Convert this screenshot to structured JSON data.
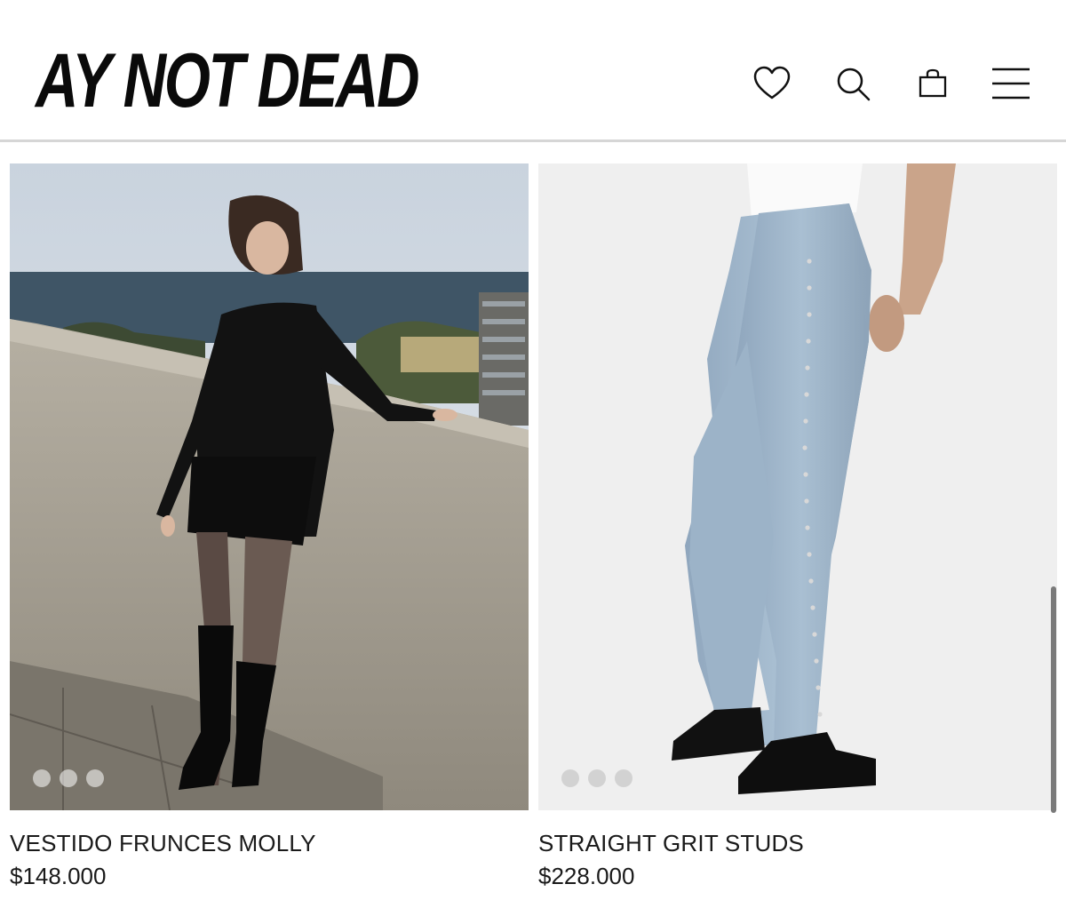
{
  "header": {
    "logo_text": "AY NOT DEAD",
    "icons": [
      "heart-icon",
      "search-icon",
      "bag-icon",
      "menu-icon"
    ]
  },
  "products": [
    {
      "name": "VESTIDO FRUNCES MOLLY",
      "price": "$148.000",
      "image_dots": 3
    },
    {
      "name": "STRAIGHT GRIT STUDS",
      "price": "$228.000",
      "image_dots": 3
    }
  ],
  "colors": {
    "text": "#111111",
    "divider": "#d6d6d6",
    "background": "#ffffff"
  }
}
